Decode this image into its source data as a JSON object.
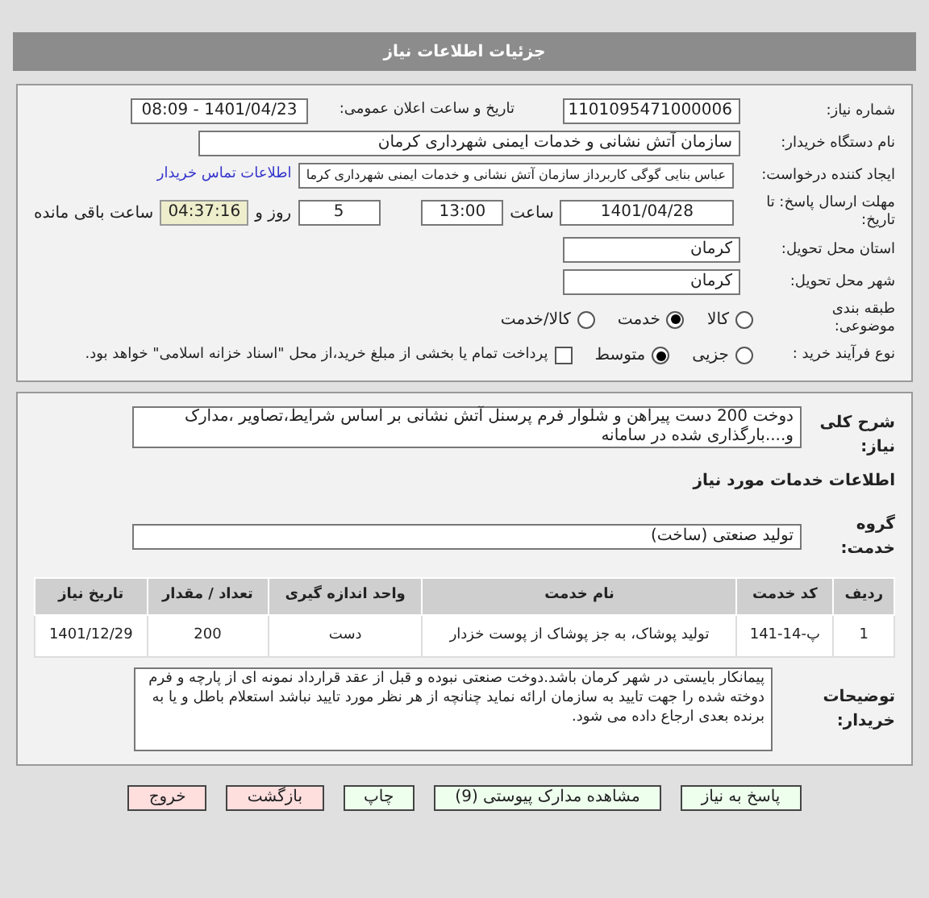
{
  "header": {
    "title": "جزئیات اطلاعات نیاز"
  },
  "need_number": {
    "label": "شماره نیاز:",
    "value": "1101095471000006"
  },
  "announce": {
    "label": "تاریخ و ساعت اعلان عمومی:",
    "value": "1401/04/23 - 08:09"
  },
  "buyer": {
    "label": "نام دستگاه خریدار:",
    "value": "سازمان آتش نشانی و خدمات ایمنی شهرداری کرمان"
  },
  "creator": {
    "label": "ایجاد کننده درخواست:",
    "value": "عباس بنایی گوگی کاربرداز سازمان آتش نشانی و خدمات ایمنی شهرداری کرما",
    "link": "اطلاعات تماس خریدار"
  },
  "deadline": {
    "label": "مهلت ارسال پاسخ: تا تاریخ:",
    "date": "1401/04/28",
    "time_label": "ساعت",
    "time": "13:00",
    "days": "5",
    "days_label": "روز و",
    "remaining": "04:37:16",
    "remaining_label": "ساعت باقی مانده"
  },
  "province": {
    "label": "استان محل تحویل:",
    "value": "کرمان"
  },
  "city": {
    "label": "شهر محل تحویل:",
    "value": "کرمان"
  },
  "category": {
    "label": "طبقه بندی موضوعی:",
    "options": [
      {
        "label": "کالا",
        "selected": false
      },
      {
        "label": "خدمت",
        "selected": true
      },
      {
        "label": "کالا/خدمت",
        "selected": false
      }
    ]
  },
  "process": {
    "label": "نوع فرآیند خرید :",
    "options": [
      {
        "label": "جزیی",
        "selected": false
      },
      {
        "label": "متوسط",
        "selected": true
      }
    ],
    "payment": {
      "label": "پرداخت تمام یا بخشی از مبلغ خرید،از محل \"اسناد خزانه اسلامی\" خواهد بود.",
      "checked": false
    }
  },
  "summary": {
    "label": "شرح کلی نیاز:",
    "value": "دوخت 200 دست پیراهن و شلوار فرم پرسنل آتش نشانی بر اساس شرایط،تصاویر ،مدارک و....بارگذاری شده در سامانه"
  },
  "services_title": "اطلاعات خدمات مورد نیاز",
  "service_group": {
    "label": "گروه خدمت:",
    "value": "تولید صنعتی (ساخت)"
  },
  "table": {
    "columns": [
      "ردیف",
      "کد خدمت",
      "نام خدمت",
      "واحد اندازه گیری",
      "تعداد / مقدار",
      "تاریخ نیاز"
    ],
    "rows": [
      [
        "1",
        "پ-14-141",
        "تولید پوشاک، به جز پوشاک از پوست خزدار",
        "دست",
        "200",
        "1401/12/29"
      ]
    ]
  },
  "notes": {
    "label": "توضیحات خریدار:",
    "value": "پیمانکار بایستی در شهر کرمان باشد.دوخت صنعتی نبوده و قبل از عقد قرارداد نمونه ای از پارچه و فرم دوخته شده را جهت تایید به سازمان ارائه نماید چنانچه از هر نظر مورد تایید نباشد استعلام باطل و یا به برنده بعدی ارجاع داده می شود."
  },
  "buttons": [
    {
      "label": "پاسخ به نیاز",
      "kind": "normal"
    },
    {
      "label": "مشاهده مدارک پیوستی (9)",
      "kind": "normal"
    },
    {
      "label": "چاپ",
      "kind": "normal"
    },
    {
      "label": "بازگشت",
      "kind": "danger"
    },
    {
      "label": "خروج",
      "kind": "danger"
    }
  ]
}
